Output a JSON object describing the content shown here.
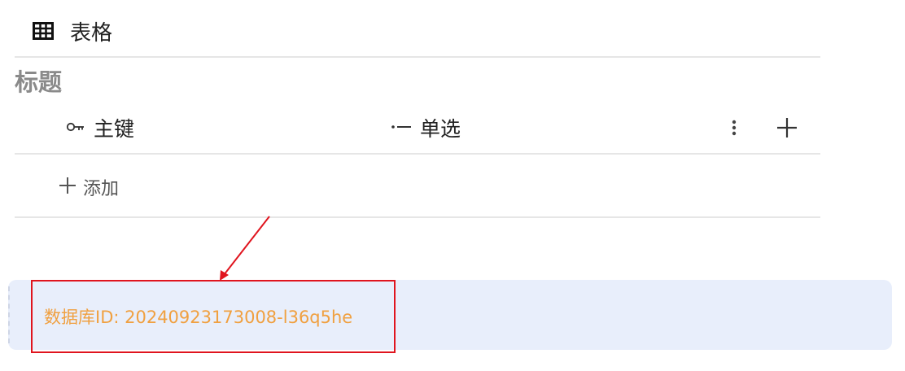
{
  "header": {
    "icon": "table-grid-icon",
    "title": "表格"
  },
  "database": {
    "title": "标题",
    "columns": [
      {
        "icon": "key-icon",
        "label": "主键"
      },
      {
        "icon": "single-select-icon",
        "label": "单选"
      }
    ],
    "add_row_label": "添加"
  },
  "info": {
    "text": "数据库ID: 20240923173008-l36q5he"
  },
  "colors": {
    "info_background": "#e8eefb",
    "info_text": "#f0a040",
    "annotation": "#e0141e"
  }
}
